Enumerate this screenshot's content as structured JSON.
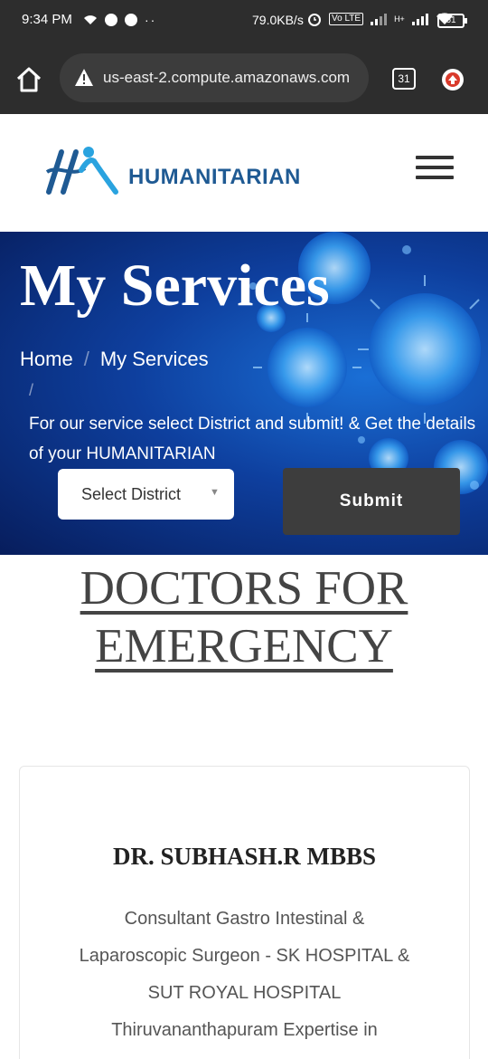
{
  "status_bar": {
    "time": "9:34 PM",
    "net_speed": "79.0KB/s",
    "battery": "61",
    "volte": "Vo LTE",
    "network": "H+"
  },
  "browser": {
    "url": "us-east-2.compute.amazonaws.com",
    "tab_count": "31"
  },
  "site": {
    "logo_text": "HUMANITARIAN",
    "brand_color": "#1f5a93"
  },
  "hero": {
    "title": "My Services",
    "breadcrumb": [
      "Home",
      "/",
      "My Services"
    ],
    "breadcrumb_trailing": "/",
    "description": "For our service select District and submit! & Get the details of your HUMANITARIAN",
    "select_label": "Select District",
    "submit_label": "Submit"
  },
  "section": {
    "heading_line1": "DOCTORS FOR",
    "heading_line2": "EMERGENCY"
  },
  "doctor": {
    "name": "DR. SUBHASH.R MBBS",
    "description_lines": [
      "Consultant Gastro Intestinal &",
      "Laparoscopic Surgeon - SK HOSPITAL &",
      "SUT ROYAL HOSPITAL",
      "Thiruvananthapuram Expertise in"
    ]
  },
  "icons": {
    "home": "home-icon",
    "warning": "warning-icon",
    "tabs": "tabs-icon",
    "update": "update-arrow-icon",
    "menu": "hamburger-menu-icon",
    "dropdown": "chevron-down-icon"
  }
}
